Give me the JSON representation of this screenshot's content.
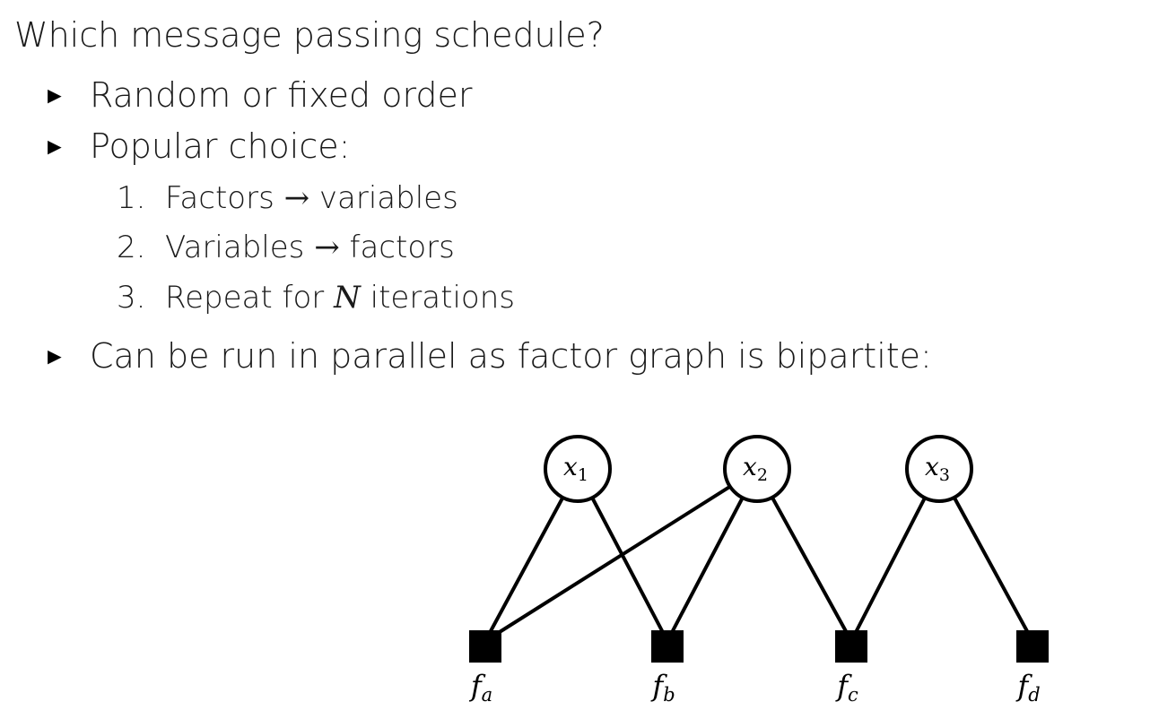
{
  "title": "Which message passing schedule?",
  "bullets": [
    {
      "text": "Random or fixed order"
    },
    {
      "text": "Popular choice:"
    },
    {
      "text": "Can be run in parallel as factor graph is bipartite:"
    }
  ],
  "steps": [
    {
      "num": "1.",
      "before": "Factors",
      "arrow": "→",
      "after": "variables"
    },
    {
      "num": "2.",
      "before": "Variables",
      "arrow": "→",
      "after": "factors"
    },
    {
      "num": "3.",
      "before": "Repeat for",
      "var": "N",
      "after": "iterations"
    }
  ],
  "graph": {
    "variables": [
      {
        "id": "x1",
        "name": "x",
        "sub": "1"
      },
      {
        "id": "x2",
        "name": "x",
        "sub": "2"
      },
      {
        "id": "x3",
        "name": "x",
        "sub": "3"
      }
    ],
    "factors": [
      {
        "id": "fa",
        "name": "f",
        "sub": "a"
      },
      {
        "id": "fb",
        "name": "f",
        "sub": "b"
      },
      {
        "id": "fc",
        "name": "f",
        "sub": "c"
      },
      {
        "id": "fd",
        "name": "f",
        "sub": "d"
      }
    ],
    "edges": [
      [
        "x1",
        "fa"
      ],
      [
        "x1",
        "fb"
      ],
      [
        "x2",
        "fa"
      ],
      [
        "x2",
        "fb"
      ],
      [
        "x2",
        "fc"
      ],
      [
        "x3",
        "fc"
      ],
      [
        "x3",
        "fd"
      ]
    ]
  }
}
